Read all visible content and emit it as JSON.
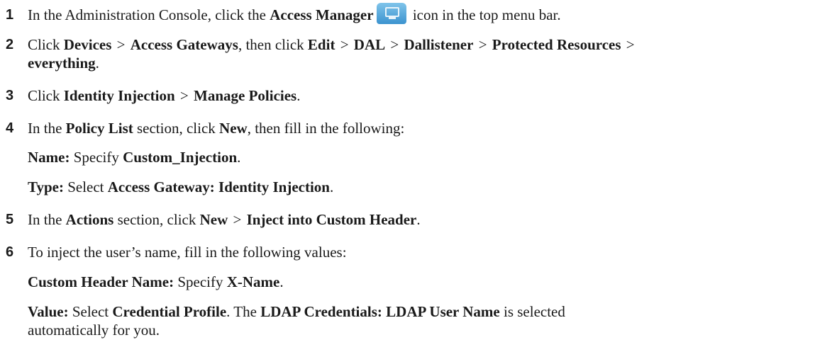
{
  "steps": [
    {
      "n": "1",
      "t1": "In the Administration Console, click the ",
      "b1": "Access Manager",
      "icon": "access-manager-icon",
      "t2": " icon in the top menu bar."
    },
    {
      "n": "2",
      "t1": "Click ",
      "b1": "Devices",
      "s1": ">",
      "b2": "Access Gateways",
      "t2": ", then click ",
      "b3": "Edit",
      "s2": ">",
      "b4": "DAL",
      "s3": ">",
      "b5": "Dallistener",
      "s4": ">",
      "b6": "Protected Resources",
      "s5": ">",
      "b7": "everything",
      "t3": "."
    },
    {
      "n": "3",
      "t1": "Click ",
      "b1": "Identity Injection",
      "s1": ">",
      "b2": "Manage Policies",
      "t2": "."
    },
    {
      "n": "4",
      "t1": "In the ",
      "b1": "Policy List",
      "t2": " section, click ",
      "b2": "New",
      "t3": ", then fill in the following:",
      "sub": [
        {
          "label": "Name:",
          "t1": " Specify ",
          "b1": "Custom_Injection",
          "t2": "."
        },
        {
          "label": "Type:",
          "t1": " Select ",
          "b1": "Access Gateway: Identity Injection",
          "t2": "."
        }
      ]
    },
    {
      "n": "5",
      "t1": "In the ",
      "b1": "Actions",
      "t2": " section, click ",
      "b2": "New",
      "s1": ">",
      "b3": "Inject into Custom Header",
      "t3": "."
    },
    {
      "n": "6",
      "t1": "To inject the user’s name, fill in the following values:",
      "sub": [
        {
          "label": "Custom Header Name:",
          "t1": " Specify ",
          "b1": "X-Name",
          "t2": "."
        },
        {
          "label": "Value:",
          "t1": " Select ",
          "b1": "Credential Profile",
          "t2": ". The ",
          "b2": "LDAP Credentials: LDAP User Name",
          "t3": " is selected",
          "line2": "automatically for you."
        }
      ]
    }
  ],
  "colors": {
    "text": "#1a1a1a",
    "icon_top": "#7fc4ea",
    "icon_bottom": "#3c93cf"
  }
}
